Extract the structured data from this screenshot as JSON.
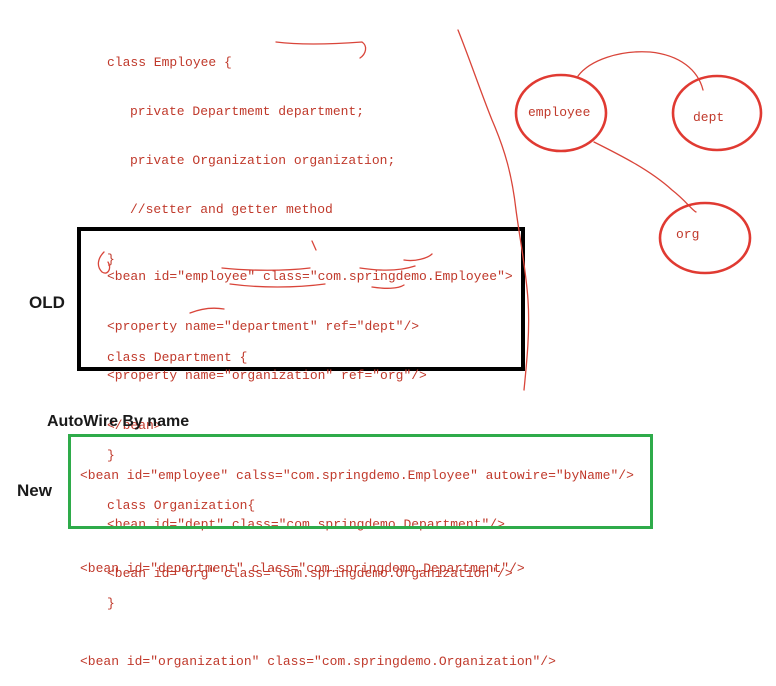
{
  "java_code": [
    "class Employee {",
    "private Departmemt department;",
    "private Organization organization;",
    "//setter and getter method",
    "}",
    "",
    "class Department {",
    "",
    "}",
    "class Organization{",
    "",
    "}"
  ],
  "old_section": {
    "label": "OLD",
    "lines": [
      "<bean id=\"employee\" class=\"com.springdemo.Employee\">",
      "<property name=\"department\" ref=\"dept\"/>",
      "<property name=\"organization\" ref=\"org\"/>",
      "</bean>",
      "",
      "<bean id=\"dept\" class=\"com.springdemo.Department\"/>",
      "<bean id=\"org\" class=\"com.springdemo.Organization\"/>"
    ]
  },
  "new_section": {
    "heading": "AutoWire By name",
    "label": "New",
    "lines": [
      "<bean id=\"employee\" calss=\"com.springdemo.Employee\" autowire=\"byName\"/>",
      "<bean id=\"department\" class=\"com.springdemo.Department\"/>",
      "<bean id=\"organization\" class=\"com.springdemo.Organization\"/>"
    ]
  },
  "diagram": {
    "nodes": [
      "employee",
      "dept",
      "org"
    ]
  },
  "colors": {
    "code": "#c0392b",
    "old_border": "#000000",
    "new_border": "#2eab4a",
    "ink": "#c0392b"
  }
}
